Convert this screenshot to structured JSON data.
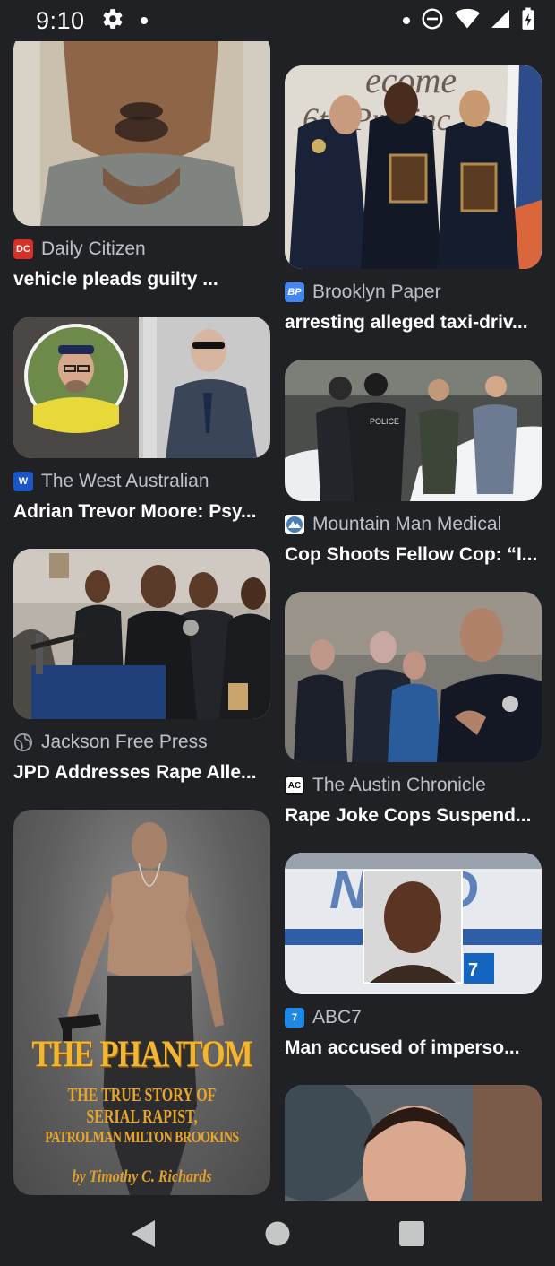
{
  "status_bar": {
    "time": "9:10"
  },
  "results": {
    "left": [
      {
        "source": "Daily Citizen",
        "favicon_text": "DC",
        "favicon_color": "#d93025",
        "title": "vehicle pleads guilty ..."
      },
      {
        "source": "The West Australian",
        "favicon_text": "W",
        "favicon_color": "#1a56c9",
        "title": "Adrian Trevor Moore: Psy..."
      },
      {
        "source": "Jackson Free Press",
        "favicon_text": "globe",
        "favicon_color": "#5f6368",
        "title": "JPD Addresses Rape Alle..."
      },
      {
        "source": "",
        "favicon_text": "",
        "favicon_color": "",
        "title": "",
        "cover_text": {
          "title": "THE PHANTOM",
          "subtitle_1": "THE TRUE STORY OF",
          "subtitle_2": "SERIAL RAPIST,",
          "subtitle_3": "PATROLMAN MILTON BROOKINS",
          "author": "by Timothy C. Richards"
        }
      }
    ],
    "right": [
      {
        "source": "Brooklyn Paper",
        "favicon_text": "BP",
        "favicon_color": "#4285f4",
        "title": "arresting alleged taxi-driv..."
      },
      {
        "source": "Mountain Man Medical",
        "favicon_text": "M",
        "favicon_color": "#4a7fb5",
        "title": "Cop Shoots Fellow Cop: “I..."
      },
      {
        "source": "The Austin Chronicle",
        "favicon_text": "AC",
        "favicon_color": "#111111",
        "title": "Rape Joke Cops Suspend..."
      },
      {
        "source": "ABC7",
        "favicon_text": "7",
        "favicon_color": "#1e88e5",
        "title": "Man accused of imperso..."
      },
      {
        "source": "",
        "favicon_text": "",
        "favicon_color": "",
        "title": ""
      }
    ]
  },
  "nav_bar": {
    "back": "back-icon",
    "home": "home-icon",
    "recents": "recents-icon"
  }
}
